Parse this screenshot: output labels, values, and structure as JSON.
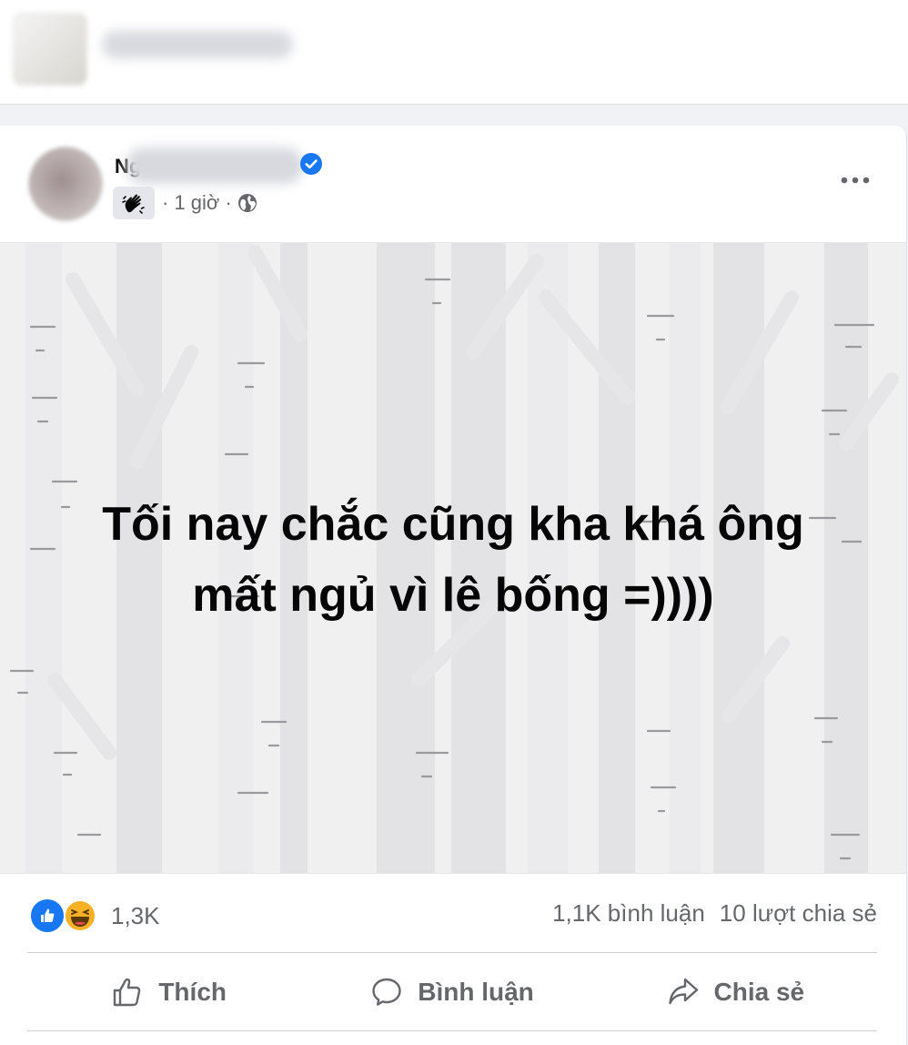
{
  "post": {
    "author_initial": "Ng",
    "time": "· 1 giờ ·",
    "text_lines": [
      "Tối nay chắc cũng kha khá ông",
      "mất ngủ vì lê bống =))))"
    ]
  },
  "stats": {
    "reactions_count": "1,3K",
    "comments": "1,1K bình luận",
    "shares": "10 lượt chia sẻ"
  },
  "actions": {
    "like": "Thích",
    "comment": "Bình luận",
    "share": "Chia sẻ"
  },
  "colors": {
    "accent": "#1877f2",
    "muted_text": "#65676b",
    "post_bg": "#f0f0f1"
  },
  "icons": [
    "verified-icon",
    "wave-badge-icon",
    "globe-icon",
    "more-icon",
    "like-reaction-icon",
    "haha-reaction-icon",
    "thumbs-up-icon",
    "comment-icon",
    "share-icon"
  ]
}
